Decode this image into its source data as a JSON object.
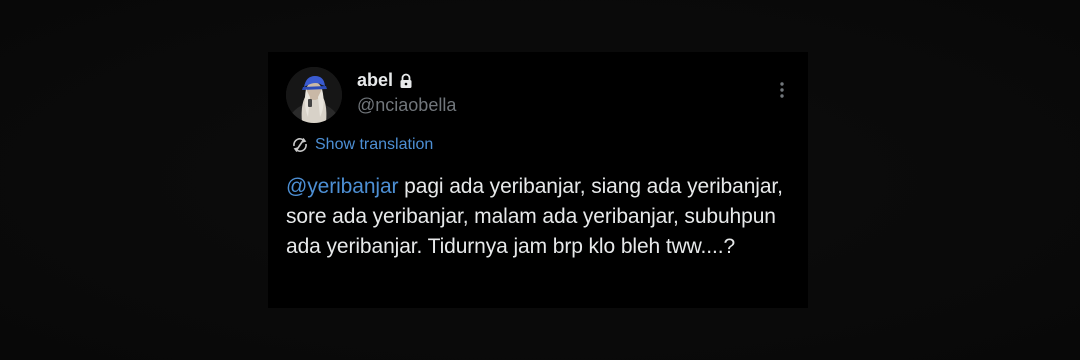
{
  "tweet": {
    "display_name": "abel",
    "handle": "@nciaobella",
    "translation_label": "Show translation",
    "mention": "@yeribanjar",
    "body_text": " pagi ada yeribanjar, siang ada yeribanjar, sore ada yeribanjar, malam ada yeribanjar, subuhpun ada yeribanjar. Tidurnya jam brp klo bleh tww....?",
    "protected": true
  },
  "icons": {
    "lock": "lock-icon",
    "more": "more-vertical-icon",
    "translate": "translate-icon"
  },
  "colors": {
    "background": "#0b0b0b",
    "card": "#000000",
    "text": "#e7e9ea",
    "secondary": "#71767b",
    "link": "#4d8fd4"
  }
}
